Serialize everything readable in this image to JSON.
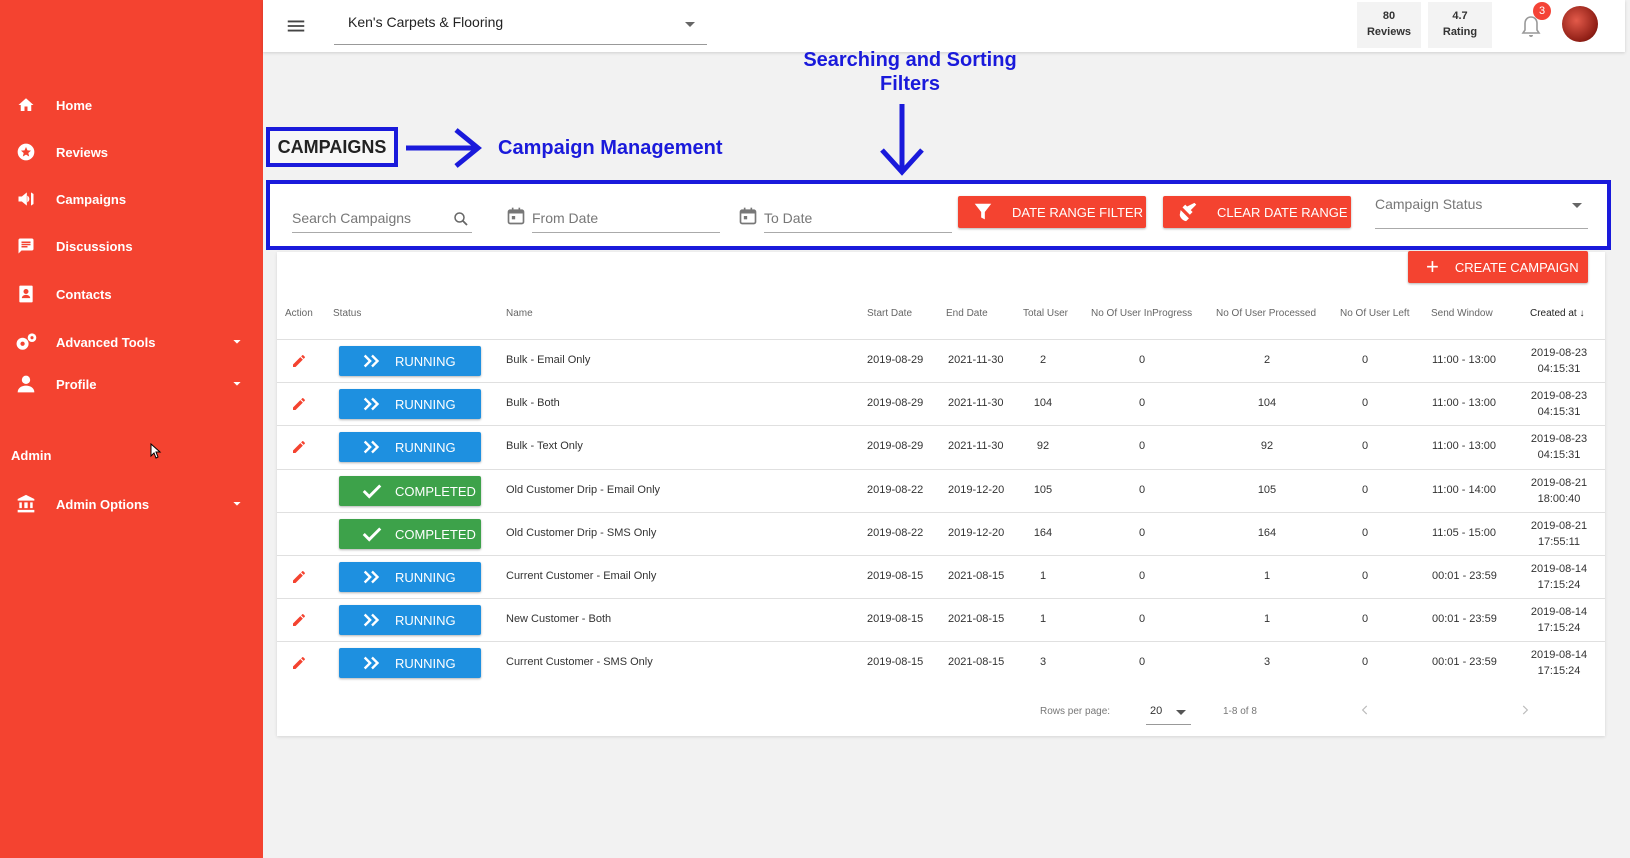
{
  "sidebar": {
    "items": [
      {
        "label": "Home",
        "icon": "home-icon"
      },
      {
        "label": "Reviews",
        "icon": "star-icon"
      },
      {
        "label": "Campaigns",
        "icon": "megaphone-icon"
      },
      {
        "label": "Discussions",
        "icon": "chat-icon"
      },
      {
        "label": "Contacts",
        "icon": "contact-book-icon"
      },
      {
        "label": "Advanced Tools",
        "icon": "gears-icon"
      },
      {
        "label": "Profile",
        "icon": "person-icon"
      }
    ],
    "admin_heading": "Admin",
    "admin_options": "Admin Options"
  },
  "topbar": {
    "business": "Ken's Carpets & Flooring",
    "reviews_count": "80",
    "reviews_label": "Reviews",
    "rating_value": "4.7",
    "rating_label": "Rating",
    "notifications": "3"
  },
  "annotations": {
    "filters_line1": "Searching and Sorting",
    "filters_line2": "Filters",
    "campaign_mgmt": "Campaign Management"
  },
  "page_title": "CAMPAIGNS",
  "filters": {
    "search_placeholder": "Search Campaigns",
    "from_placeholder": "From Date",
    "to_placeholder": "To Date",
    "date_range_button": "DATE RANGE FILTER",
    "clear_button": "CLEAR DATE RANGE",
    "status_placeholder": "Campaign Status"
  },
  "create_button": "CREATE CAMPAIGN",
  "table": {
    "headers": {
      "action": "Action",
      "status": "Status",
      "name": "Name",
      "start": "Start Date",
      "end": "End Date",
      "total": "Total User",
      "inprogress": "No Of User InProgress",
      "processed": "No Of User Processed",
      "left": "No Of User Left",
      "window": "Send Window",
      "created": "Created at"
    },
    "rows": [
      {
        "status": "RUNNING",
        "name": "Bulk - Email Only",
        "start": "2019-08-29",
        "end": "2021-11-30",
        "total": "2",
        "inprogress": "0",
        "processed": "2",
        "left": "0",
        "window": "11:00 - 13:00",
        "created_date": "2019-08-23",
        "created_time": "04:15:31"
      },
      {
        "status": "RUNNING",
        "name": "Bulk - Both",
        "start": "2019-08-29",
        "end": "2021-11-30",
        "total": "104",
        "inprogress": "0",
        "processed": "104",
        "left": "0",
        "window": "11:00 - 13:00",
        "created_date": "2019-08-23",
        "created_time": "04:15:31"
      },
      {
        "status": "RUNNING",
        "name": "Bulk - Text Only",
        "start": "2019-08-29",
        "end": "2021-11-30",
        "total": "92",
        "inprogress": "0",
        "processed": "92",
        "left": "0",
        "window": "11:00 - 13:00",
        "created_date": "2019-08-23",
        "created_time": "04:15:31"
      },
      {
        "status": "COMPLETED",
        "name": "Old Customer Drip - Email Only",
        "start": "2019-08-22",
        "end": "2019-12-20",
        "total": "105",
        "inprogress": "0",
        "processed": "105",
        "left": "0",
        "window": "11:00 - 14:00",
        "created_date": "2019-08-21",
        "created_time": "18:00:40"
      },
      {
        "status": "COMPLETED",
        "name": "Old Customer Drip - SMS Only",
        "start": "2019-08-22",
        "end": "2019-12-20",
        "total": "164",
        "inprogress": "0",
        "processed": "164",
        "left": "0",
        "window": "11:05 - 15:00",
        "created_date": "2019-08-21",
        "created_time": "17:55:11"
      },
      {
        "status": "RUNNING",
        "name": "Current Customer - Email Only",
        "start": "2019-08-15",
        "end": "2021-08-15",
        "total": "1",
        "inprogress": "0",
        "processed": "1",
        "left": "0",
        "window": "00:01 - 23:59",
        "created_date": "2019-08-14",
        "created_time": "17:15:24"
      },
      {
        "status": "RUNNING",
        "name": "New Customer - Both",
        "start": "2019-08-15",
        "end": "2021-08-15",
        "total": "1",
        "inprogress": "0",
        "processed": "1",
        "left": "0",
        "window": "00:01 - 23:59",
        "created_date": "2019-08-14",
        "created_time": "17:15:24"
      },
      {
        "status": "RUNNING",
        "name": "Current Customer - SMS Only",
        "start": "2019-08-15",
        "end": "2021-08-15",
        "total": "3",
        "inprogress": "0",
        "processed": "3",
        "left": "0",
        "window": "00:01 - 23:59",
        "created_date": "2019-08-14",
        "created_time": "17:15:24"
      }
    ]
  },
  "pagination": {
    "rows_label": "Rows per page:",
    "rows_value": "20",
    "range": "1-8 of 8"
  },
  "colors": {
    "brand": "#f44330",
    "running": "#1e90e0",
    "completed": "#3da24a",
    "annotation": "#1a1adb"
  }
}
